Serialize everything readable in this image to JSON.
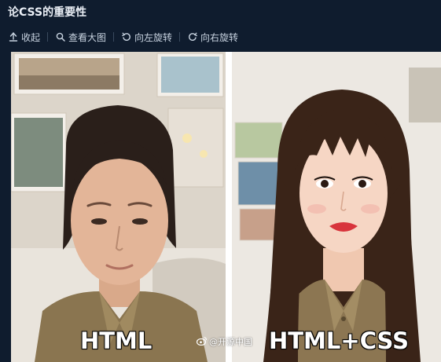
{
  "post": {
    "title": "论CSS的重要性"
  },
  "toolbar": {
    "collapse_label": "收起",
    "view_large_label": "查看大图",
    "rotate_left_label": "向左旋转",
    "rotate_right_label": "向右旋转",
    "collapse_icon": "collapse-arrow-icon",
    "view_large_icon": "magnifier-icon",
    "rotate_left_icon": "rotate-left-icon",
    "rotate_right_icon": "rotate-right-icon"
  },
  "image": {
    "caption_left": "HTML",
    "caption_right": "HTML+CSS",
    "watermark": "@开源中国",
    "watermark_icon": "weibo-icon"
  },
  "colors": {
    "background": "#0f1c2e",
    "title_text": "#e9eef5",
    "toolbar_text": "#c8d3e0"
  }
}
